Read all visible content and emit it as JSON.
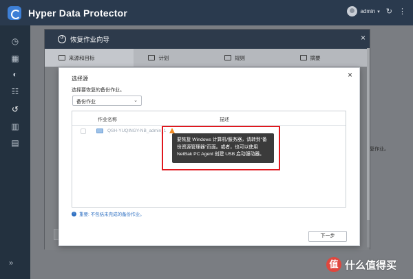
{
  "app": {
    "title": "Hyper Data Protector"
  },
  "topbar": {
    "user": "admin",
    "user_caret": "▾",
    "refresh_icon": "refresh-icon",
    "menu_icon": "more-icon"
  },
  "sidebar": {
    "items": [
      {
        "icon": "dashboard-icon",
        "glyph": "◷"
      },
      {
        "icon": "overview-grid-icon",
        "glyph": "▦"
      },
      {
        "icon": "sync-icon",
        "glyph": "◐"
      },
      {
        "icon": "jobs-icon",
        "glyph": "☷"
      },
      {
        "icon": "restore-icon",
        "glyph": "↺"
      },
      {
        "icon": "report-icon",
        "glyph": "▥"
      },
      {
        "icon": "logs-icon",
        "glyph": "▤"
      }
    ],
    "expand_glyph": "»"
  },
  "background": {
    "text": "复作业。"
  },
  "wizard": {
    "title": "恢复作业向导",
    "close": "×",
    "steps": [
      {
        "label": "来源和目标"
      },
      {
        "label": "计划"
      },
      {
        "label": "规则"
      },
      {
        "label": "摘要"
      }
    ]
  },
  "dialog": {
    "close": "×",
    "title": "选择源",
    "subtitle": "选择要恢复的备份作业。",
    "select": {
      "value": "备份作业",
      "chevron": "⌄"
    },
    "table": {
      "columns": [
        "作业名称",
        "描述"
      ],
      "rows": [
        {
          "name": "QSH-YUQINGY-NB_admin_1",
          "description": ""
        }
      ]
    },
    "note": "重要: 不包括未完成的备份作业。",
    "next_button": "下一步"
  },
  "tooltip": {
    "lines": [
      "要恢复 Windows 计算机/服务器，请转到\"备",
      "份资源管理器\"页面。或者，也可以使用",
      "NetBak PC Agent 创建 USB 启动服动器。"
    ]
  },
  "watermark": {
    "logo": "值",
    "text": "什么值得买"
  },
  "colors": {
    "topbar": "#2a3a4e",
    "sidebar": "#23313f",
    "accent": "#2d6fc2",
    "highlight": "#e0181e",
    "warning": "#f08a24"
  }
}
